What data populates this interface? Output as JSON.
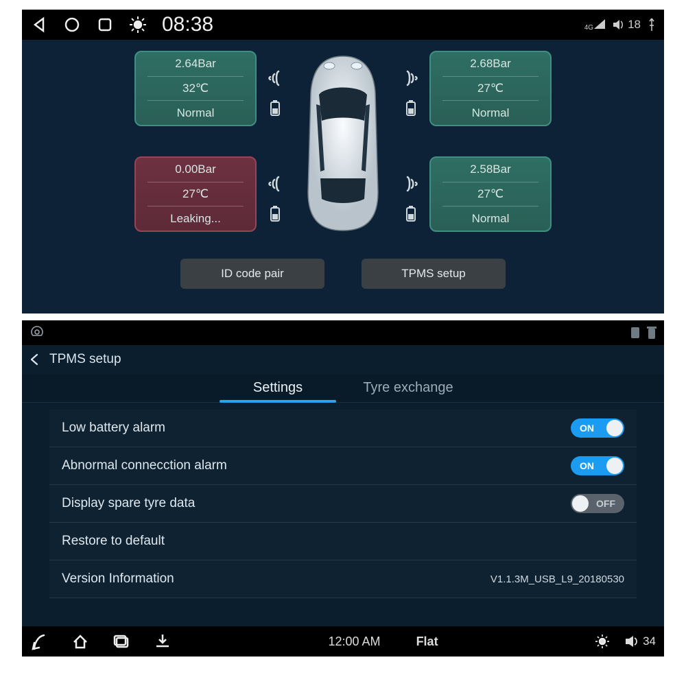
{
  "screen1": {
    "statusbar": {
      "time": "08:38",
      "net": "4G",
      "volume": "18"
    },
    "tires": {
      "frontLeft": {
        "pressure": "2.64Bar",
        "temp": "32℃",
        "status": "Normal",
        "ok": true
      },
      "frontRight": {
        "pressure": "2.68Bar",
        "temp": "27℃",
        "status": "Normal",
        "ok": true
      },
      "rearLeft": {
        "pressure": "0.00Bar",
        "temp": "27℃",
        "status": "Leaking...",
        "ok": false
      },
      "rearRight": {
        "pressure": "2.58Bar",
        "temp": "27℃",
        "status": "Normal",
        "ok": true
      }
    },
    "buttons": {
      "id_pair": "ID code pair",
      "tpms_setup": "TPMS setup"
    }
  },
  "screen2": {
    "title": "TPMS setup",
    "tabs": {
      "settings": "Settings",
      "tyre_exchange": "Tyre exchange"
    },
    "settings": {
      "low_battery": {
        "label": "Low battery alarm",
        "state": "ON"
      },
      "abnormal_conn": {
        "label": "Abnormal connecction alarm",
        "state": "ON"
      },
      "display_spare": {
        "label": "Display spare tyre data",
        "state": "OFF"
      },
      "restore_default": {
        "label": "Restore to default"
      },
      "version_info": {
        "label": "Version Information",
        "value": "V1.1.3M_USB_L9_20180530"
      }
    },
    "navbar": {
      "time": "12:00 AM",
      "mode": "Flat",
      "volume": "34"
    }
  }
}
